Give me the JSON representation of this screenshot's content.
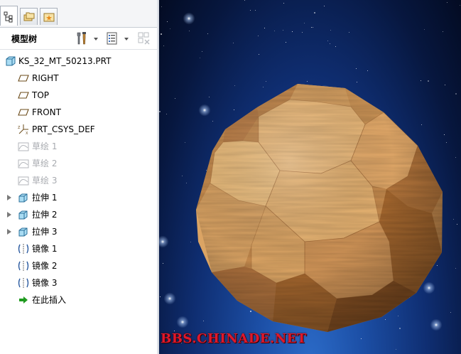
{
  "panel": {
    "title": "模型树",
    "tabs": [
      {
        "name": "model-tree-tab",
        "icon": "tree-icon",
        "active": true
      },
      {
        "name": "folder-browser-tab",
        "icon": "folders-icon",
        "active": false
      },
      {
        "name": "favorites-tab",
        "icon": "star-folder-icon",
        "active": false
      }
    ],
    "tools": [
      {
        "icon": "settings-tools-icon"
      },
      {
        "icon": "show-list-icon"
      },
      {
        "icon": "filter-columns-icon"
      }
    ]
  },
  "tree": {
    "root": {
      "label": "KS_32_MT_50213.PRT",
      "icon": "part-icon"
    },
    "items": [
      {
        "label": "RIGHT",
        "icon": "datum-plane-icon",
        "expandable": false,
        "dim": false
      },
      {
        "label": "TOP",
        "icon": "datum-plane-icon",
        "expandable": false,
        "dim": false
      },
      {
        "label": "FRONT",
        "icon": "datum-plane-icon",
        "expandable": false,
        "dim": false
      },
      {
        "label": "PRT_CSYS_DEF",
        "icon": "coordinate-system-icon",
        "expandable": false,
        "dim": false
      },
      {
        "label": "草绘 1",
        "icon": "sketch-icon",
        "expandable": false,
        "dim": true
      },
      {
        "label": "草绘 2",
        "icon": "sketch-icon",
        "expandable": false,
        "dim": true
      },
      {
        "label": "草绘 3",
        "icon": "sketch-icon",
        "expandable": false,
        "dim": true
      },
      {
        "label": "拉伸 1",
        "icon": "extrude-icon",
        "expandable": true,
        "dim": false
      },
      {
        "label": "拉伸 2",
        "icon": "extrude-icon",
        "expandable": true,
        "dim": false
      },
      {
        "label": "拉伸 3",
        "icon": "extrude-icon",
        "expandable": true,
        "dim": false
      },
      {
        "label": "镜像 1",
        "icon": "mirror-icon",
        "expandable": false,
        "dim": false
      },
      {
        "label": "镜像 2",
        "icon": "mirror-icon",
        "expandable": false,
        "dim": false
      },
      {
        "label": "镜像 3",
        "icon": "mirror-icon",
        "expandable": false,
        "dim": false
      },
      {
        "label": "在此插入",
        "icon": "insert-here-arrow-icon",
        "expandable": false,
        "dim": false
      }
    ]
  },
  "viewport": {
    "watermark": "BBS.CHINADE.NET",
    "colors": {
      "wood_light": "#f2be7e",
      "wood_mid": "#d79a59",
      "wood_dark": "#9a5f2a",
      "space": "#0f2e72"
    }
  }
}
